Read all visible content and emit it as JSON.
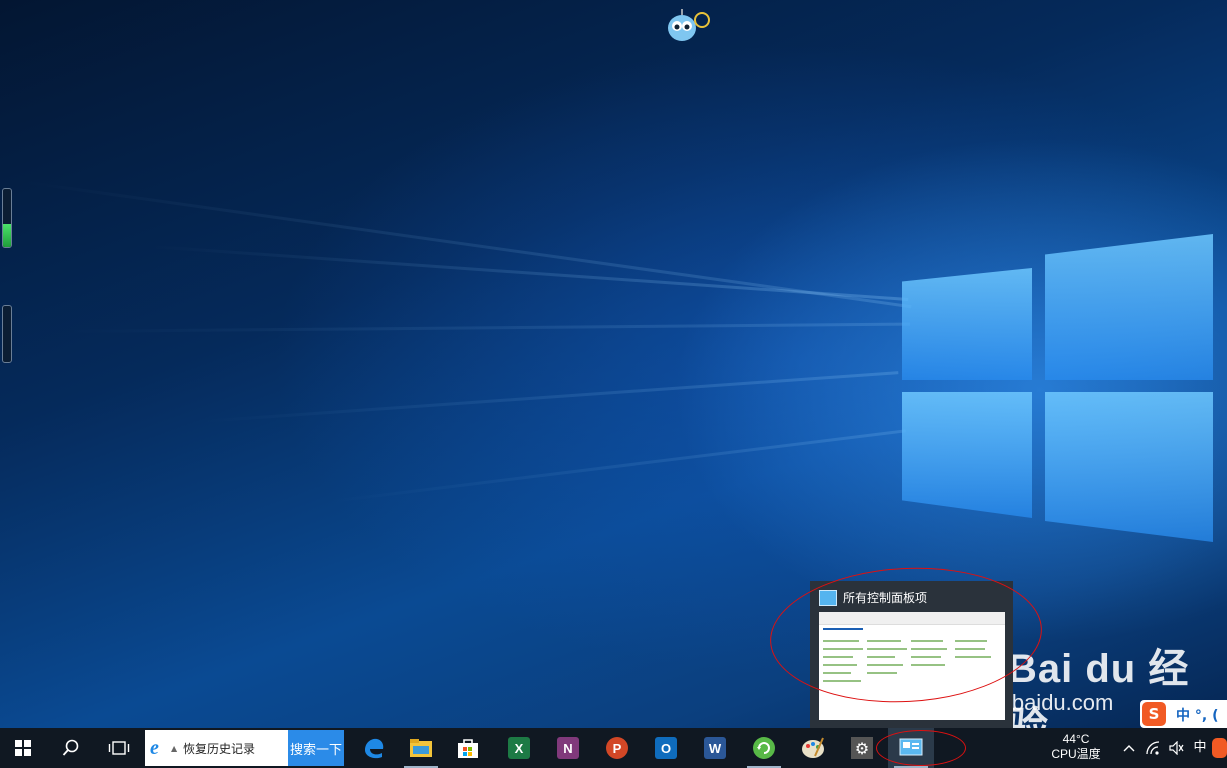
{
  "desktop": {
    "wallpaper": "windows-10-hero",
    "accent": "#1e88e5",
    "watermark": {
      "logo_text": "Bai du 经验",
      "site": "jingyan.baidu.com"
    }
  },
  "thumbnail": {
    "title": "所有控制面板项",
    "icon": "control-panel-icon"
  },
  "ime_bar": {
    "logo": "S",
    "text": "中 °, ("
  },
  "taskbar": {
    "search": {
      "current_value": "恢复历史记录",
      "button_label": "搜索一下"
    },
    "apps": [
      {
        "name": "edge-icon"
      },
      {
        "name": "file-explorer-icon"
      },
      {
        "name": "store-icon"
      },
      {
        "name": "excel-icon",
        "letter": "X",
        "color": "#1d7a45"
      },
      {
        "name": "onenote-icon",
        "letter": "N",
        "color": "#80397b"
      },
      {
        "name": "powerpoint-icon",
        "letter": "P",
        "color": "#d24726"
      },
      {
        "name": "outlook-icon",
        "letter": "O",
        "color": "#0f6cbd"
      },
      {
        "name": "word-icon",
        "letter": "W",
        "color": "#2b5797"
      },
      {
        "name": "refresh-app-icon"
      },
      {
        "name": "paint-icon"
      },
      {
        "name": "settings-icon"
      },
      {
        "name": "control-panel-icon"
      }
    ],
    "tray": {
      "cpu_temp": "44°C",
      "cpu_label": "CPU温度",
      "ime_indicator": "中"
    }
  }
}
